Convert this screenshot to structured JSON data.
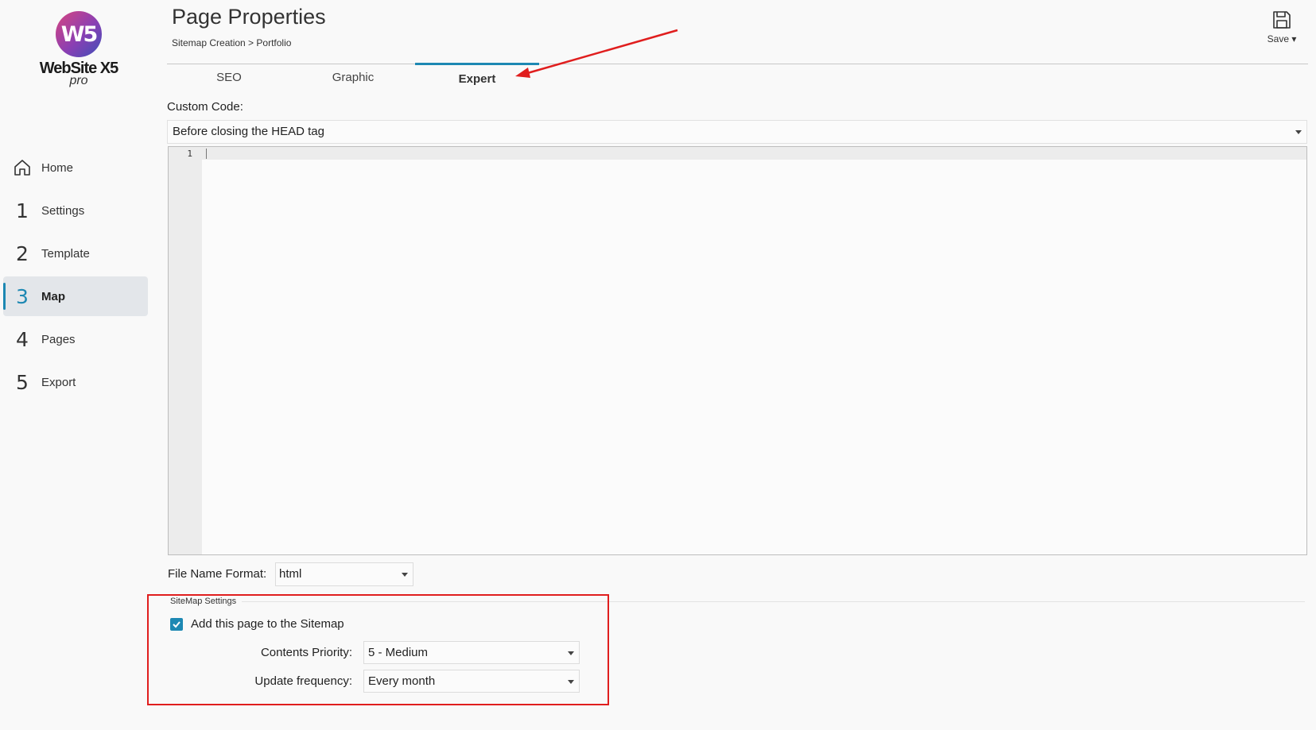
{
  "app": {
    "logo_text": "W5",
    "logo_name": "WebSite X5",
    "logo_edition": "pro"
  },
  "sidebar": {
    "items": [
      {
        "icon": "home-icon",
        "label": "Home"
      },
      {
        "num": "1",
        "label": "Settings"
      },
      {
        "num": "2",
        "label": "Template"
      },
      {
        "num": "3",
        "label": "Map",
        "active": true
      },
      {
        "num": "4",
        "label": "Pages"
      },
      {
        "num": "5",
        "label": "Export"
      }
    ]
  },
  "header": {
    "title": "Page Properties",
    "breadcrumb": "Sitemap Creation > Portfolio",
    "save_label": "Save ▾"
  },
  "tabs": [
    {
      "label": "SEO"
    },
    {
      "label": "Graphic"
    },
    {
      "label": "Expert",
      "active": true
    }
  ],
  "custom_code": {
    "label": "Custom Code:",
    "position_value": "Before closing the HEAD tag",
    "line_number": "1"
  },
  "file_name_format": {
    "label": "File Name Format:",
    "value": "html"
  },
  "sitemap": {
    "legend": "SiteMap Settings",
    "add_label": "Add this page to the Sitemap",
    "add_checked": true,
    "priority_label": "Contents Priority:",
    "priority_value": "5 - Medium",
    "frequency_label": "Update frequency:",
    "frequency_value": "Every month"
  },
  "colors": {
    "accent": "#1d88b3",
    "annotation": "#e01e1e"
  }
}
